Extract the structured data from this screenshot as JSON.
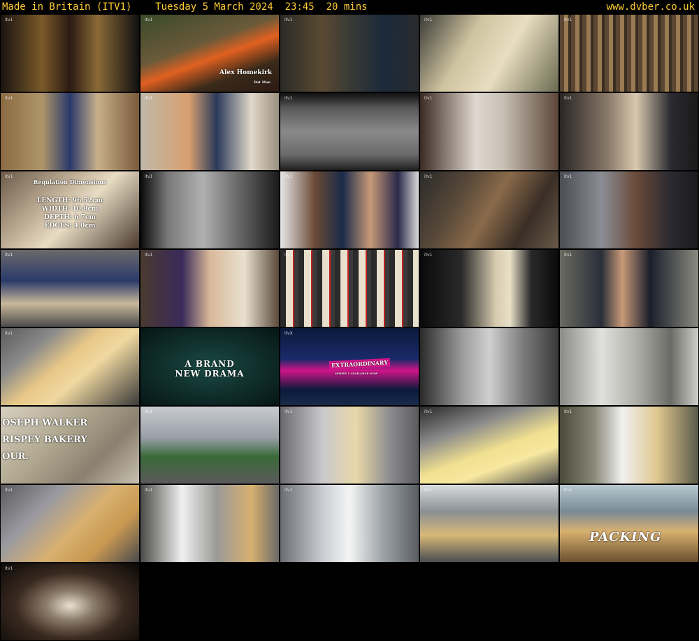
{
  "header": {
    "title": "Made in Britain (ITV1)    Tuesday 5 March 2024  23:45  20 mins",
    "site": "www.dvber.co.uk"
  },
  "thumbs": [
    {
      "bg": "linear-gradient(90deg,#1a1410 0%,#7a5a2a 30%,#2a1a12 50%,#8a6a36 70%,#101010 100%)",
      "wm": "itv1"
    },
    {
      "bg": "linear-gradient(160deg,#3a4a2a 0%,#6a5a3a 40%,#e06020 55%,#3a2a1a 75%,#2a1a12 100%)",
      "wm": "itv1",
      "caption": "Alex Homekirk",
      "subcaption": "Bat Man"
    },
    {
      "bg": "linear-gradient(90deg,#2a2a26 0%,#5a4a32 30%,#3a3a36 50%,#1a2a3a 75%,#2a2a2e 100%)",
      "wm": "itv1"
    },
    {
      "bg": "linear-gradient(120deg,#3a3a36 0%,#cfc4a0 35%,#e8ddc0 60%,#6a6a50 100%)",
      "wm": "itv1"
    },
    {
      "bg": "repeating-linear-gradient(90deg,#5a4632 0 6px,#9a7a52 6px 12px,#3a2e22 12px 16px)",
      "wm": "itv1"
    },
    {
      "bg": "linear-gradient(90deg,#8a6a42 0%,#b0956a 30%,#2a3a6a 50%,#c8b08a 70%,#7a5a3a 100%)",
      "wm": "itv1"
    },
    {
      "bg": "linear-gradient(90deg,#c0b8a8 0%,#d8a070 35%,#2a3a5a 55%,#e0d8c8 80%,#9a9080 100%)",
      "wm": "itv1"
    },
    {
      "bg": "linear-gradient(180deg,#101010 0%,#5a5a5a 20%,#8a8a8a 50%,#6a6a6a 80%,#202020 100%)",
      "wm": "itv1"
    },
    {
      "bg": "linear-gradient(90deg,#3a2a22 0%,#e0d8d0 40%,#c8c0b4 60%,#5a4638 100%)",
      "wm": "itv1"
    },
    {
      "bg": "linear-gradient(90deg,#2a2624 0%,#8a7a6a 35%,#d8c8b0 55%,#2a2a30 80%,#1a1a1a 100%)",
      "wm": "itv1"
    },
    {
      "bg": "linear-gradient(135deg,#6a5a48 0%,#c8b8a0 40%,#e8dcc4 55%,#4a3a2e 100%)",
      "wm": "itv1",
      "dimTitle": "Regulation Dimensions",
      "dims": [
        "LENGTH: 96.52cm",
        "WIDTH: 10.8cm",
        "DEPTH: 6.7cm",
        "EDGES: 4.0cm"
      ]
    },
    {
      "bg": "linear-gradient(90deg,#0a0a0a 0%,#7a7a7a 20%,#b0b0b0 45%,#6a6a6a 70%,#1a1a1a 100%)",
      "wm": "itv1"
    },
    {
      "bg": "linear-gradient(90deg,#e8e8e8 0%,#6a4a36 25%,#1a2a4a 45%,#c89a78 65%,#2a2a4a 85%,#dadada 100%)",
      "wm": "itv1"
    },
    {
      "bg": "linear-gradient(120deg,#2a2a2a 0%,#5a4a3a 30%,#8a6a4a 50%,#3a2e26 75%,#6a5a4a 100%)",
      "wm": "itv1"
    },
    {
      "bg": "linear-gradient(90deg,#4a4e54 0%,#8a8e94 30%,#6a4a3a 55%,#2a2a30 80%,#1a1a1e 100%)",
      "wm": "itv1"
    },
    {
      "bg": "linear-gradient(180deg,#6a6a6a 0%,#2a3a6a 40%,#c8b89a 70%,#4a4a4a 100%)",
      "wm": "itv1"
    },
    {
      "bg": "linear-gradient(90deg,#4a3a30 0%,#3a2a5a 30%,#d8b898 50%,#e8e0d0 75%,#5a4a3a 100%)",
      "wm": "itv1"
    },
    {
      "bg": "repeating-linear-gradient(90deg,#2a2a2a 0 8px,#e8e0cc 8px 18px,#c02020 18px 20px,#3a3a3a 20px 26px)",
      "wm": "itv1"
    },
    {
      "bg": "linear-gradient(90deg,#0a0a0a 0%,#2a2a2a 30%,#d8ccb0 55%,#e8e0c8 65%,#2a2a2a 80%,#0a0a0a 100%)",
      "wm": "itv1"
    },
    {
      "bg": "linear-gradient(90deg,#6a6a60 0%,#2a2e3a 30%,#c89a78 45%,#1a1e2a 65%,#8a8a80 100%)",
      "wm": "itv1"
    },
    {
      "bg": "linear-gradient(140deg,#5a5a5a 0%,#8a8a8a 25%,#e8c888 45%,#f0d8a0 60%,#3a3a3a 100%)",
      "wm": "itv1"
    },
    {
      "bg": "radial-gradient(ellipse at center,#1a4a44 0%,#0e2a28 60%,#061614 100%)",
      "wm": "",
      "drama": [
        "A BRAND",
        "NEW DRAMA"
      ]
    },
    {
      "bg": "linear-gradient(180deg,#0a1a3a 0%,#1a2a6a 40%,#d0148a 55%,#0a1a3a 80%,#1a2a4a 100%)",
      "wm": "itvX",
      "show": "EXTRAORDINARY",
      "showSub": "SERIES 1 AVAILABLE NOW"
    },
    {
      "bg": "linear-gradient(90deg,#2a2a2a 0%,#9a9a9a 30%,#d0d0d0 50%,#7a7a7a 75%,#3a3a3a 100%)",
      "wm": ""
    },
    {
      "bg": "linear-gradient(90deg,#8a8a86 0%,#e0e0dc 30%,#b0b0aa 55%,#6a6a66 80%,#d0d0ca 100%)",
      "wm": ""
    },
    {
      "bg": "linear-gradient(135deg,#d8d0c0 0%,#b0a890 40%,#8a8070 70%,#c8c0b0 100%)",
      "wm": "",
      "bakery": [
        "OSEPH WALKER",
        "RISPEY BAKERY",
        "OUR."
      ]
    },
    {
      "bg": "linear-gradient(180deg,#c8ccd0 0%,#9aa0a8 40%,#3a6a3a 65%,#5a5a5a 100%)",
      "wm": "itv1"
    },
    {
      "bg": "linear-gradient(90deg,#6a6a6e 0%,#c8c8cc 30%,#e8d8a8 55%,#8a8a8e 80%,#5a5a5e 100%)",
      "wm": "itv1"
    },
    {
      "bg": "linear-gradient(160deg,#2a2a2a 0%,#8a8a8a 30%,#f0e090 55%,#f8e8a0 70%,#4a4a4a 100%)",
      "wm": "itv1"
    },
    {
      "bg": "linear-gradient(90deg,#4a4a3a 0%,#8a8a7a 25%,#f0f0f0 45%,#e0c890 70%,#5a5a4a 100%)",
      "wm": "itv1"
    },
    {
      "bg": "linear-gradient(135deg,#5a5a5e 0%,#9a9aa0 30%,#d8b070 55%,#c89850 75%,#4a4a4e 100%)",
      "wm": "itv1"
    },
    {
      "bg": "linear-gradient(90deg,#4a4a48 0%,#f0f0f0 30%,#9a9a98 55%,#d8b070 80%,#6a6a68 100%)",
      "wm": "itv1"
    },
    {
      "bg": "linear-gradient(90deg,#6a6e72 0%,#c8ccd0 30%,#f4f4f4 50%,#9aa0a4 75%,#5a5e62 100%)",
      "wm": "itv1"
    },
    {
      "bg": "linear-gradient(180deg,#d8dcdc 0%,#8a9094 35%,#d8b878 65%,#4a4e52 100%)",
      "wm": "itv1"
    },
    {
      "bg": "linear-gradient(180deg,#b8c8d0 0%,#7a8a94 35%,#d8b070 60%,#6a5030 100%)",
      "wm": "itv1",
      "packing": "PACKING"
    },
    {
      "bg": "radial-gradient(ellipse at 50% 55%,#e8e0d0 0%,#8a7a68 25%,#3a2a20 55%,#0a0806 100%)",
      "wm": "itv1"
    }
  ]
}
